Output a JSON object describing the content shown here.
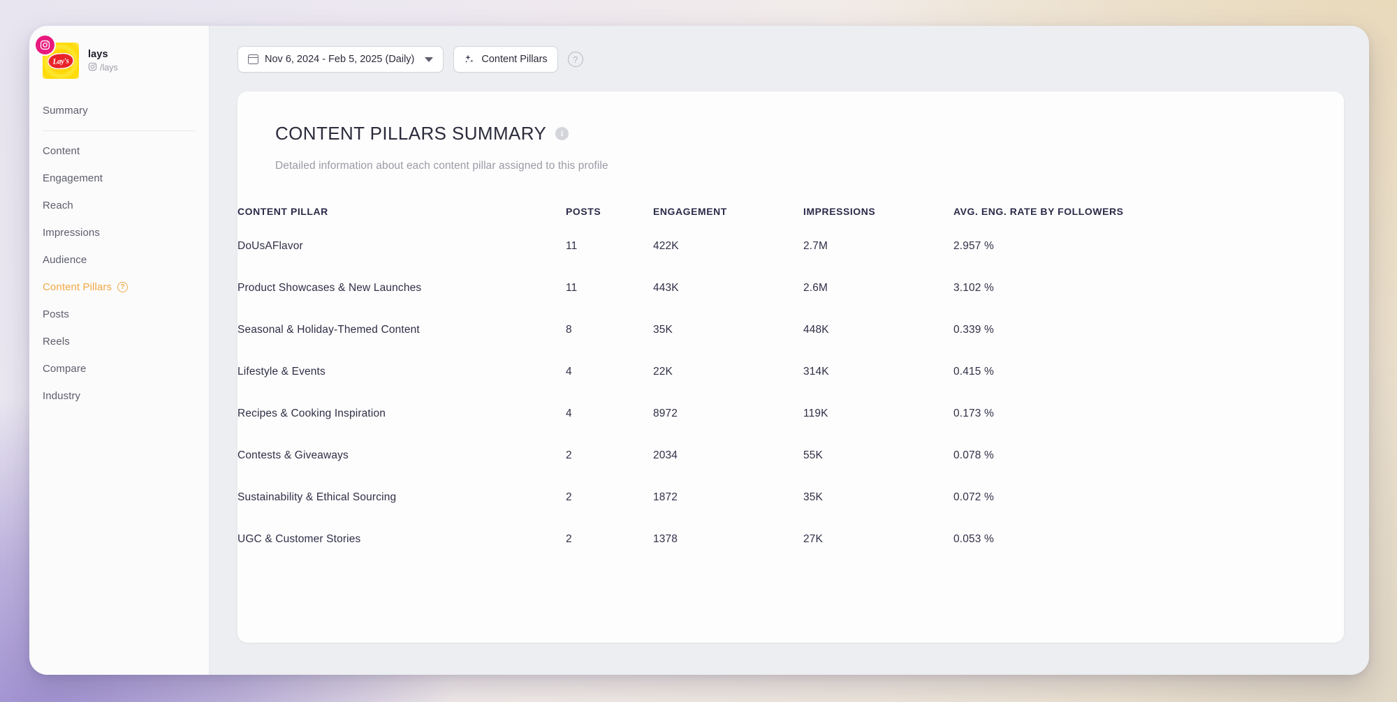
{
  "profile": {
    "name": "lays",
    "handle": "/lays",
    "platform_icon": "instagram-icon",
    "avatar_label": "Lay's"
  },
  "sidebar": {
    "items": [
      {
        "label": "Summary",
        "active": false,
        "help": false
      },
      {
        "label": "Content",
        "active": false,
        "help": false
      },
      {
        "label": "Engagement",
        "active": false,
        "help": false
      },
      {
        "label": "Reach",
        "active": false,
        "help": false
      },
      {
        "label": "Impressions",
        "active": false,
        "help": false
      },
      {
        "label": "Audience",
        "active": false,
        "help": false
      },
      {
        "label": "Content Pillars",
        "active": true,
        "help": true
      },
      {
        "label": "Posts",
        "active": false,
        "help": false
      },
      {
        "label": "Reels",
        "active": false,
        "help": false
      },
      {
        "label": "Compare",
        "active": false,
        "help": false
      },
      {
        "label": "Industry",
        "active": false,
        "help": false
      }
    ],
    "active_color": "#f2a844"
  },
  "toolbar": {
    "date_range": "Nov 6, 2024 - Feb 5, 2025 (Daily)",
    "date_icon": "calendar-icon",
    "content_pillars_label": "Content Pillars",
    "content_pillars_icon": "sparkle-icon",
    "help_label": "?"
  },
  "card": {
    "title": "CONTENT PILLARS SUMMARY",
    "info_icon": "info-icon",
    "subtitle": "Detailed information about each content pillar assigned to this profile"
  },
  "table": {
    "columns": [
      "CONTENT PILLAR",
      "POSTS",
      "ENGAGEMENT",
      "IMPRESSIONS",
      "AVG. ENG. RATE BY FOLLOWERS"
    ],
    "rows": [
      {
        "pillar": "DoUsAFlavor",
        "posts": "11",
        "engagement": "422K",
        "impressions": "2.7M",
        "rate": "2.957 %"
      },
      {
        "pillar": "Product Showcases & New Launches",
        "posts": "11",
        "engagement": "443K",
        "impressions": "2.6M",
        "rate": "3.102 %"
      },
      {
        "pillar": "Seasonal & Holiday-Themed Content",
        "posts": "8",
        "engagement": "35K",
        "impressions": "448K",
        "rate": "0.339 %"
      },
      {
        "pillar": "Lifestyle & Events",
        "posts": "4",
        "engagement": "22K",
        "impressions": "314K",
        "rate": "0.415 %"
      },
      {
        "pillar": "Recipes & Cooking Inspiration",
        "posts": "4",
        "engagement": "8972",
        "impressions": "119K",
        "rate": "0.173 %"
      },
      {
        "pillar": "Contests & Giveaways",
        "posts": "2",
        "engagement": "2034",
        "impressions": "55K",
        "rate": "0.078 %"
      },
      {
        "pillar": "Sustainability & Ethical Sourcing",
        "posts": "2",
        "engagement": "1872",
        "impressions": "35K",
        "rate": "0.072 %"
      },
      {
        "pillar": "UGC & Customer Stories",
        "posts": "2",
        "engagement": "1378",
        "impressions": "27K",
        "rate": "0.053 %"
      }
    ]
  }
}
